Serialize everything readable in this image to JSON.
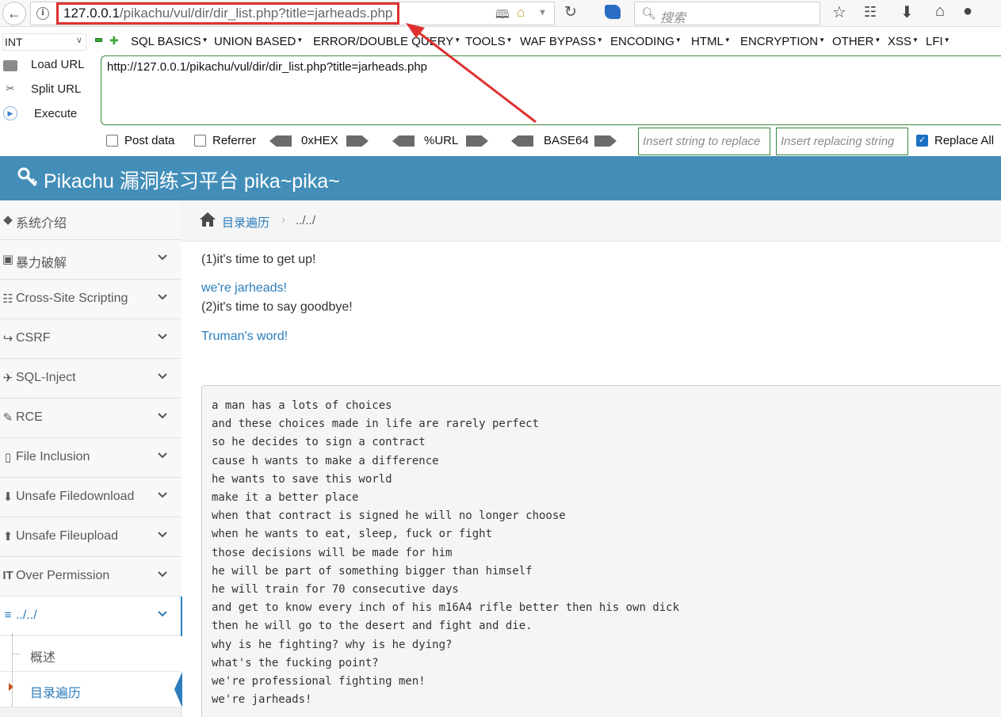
{
  "browser": {
    "url_host": "127.0.0.1",
    "url_path": "/pikachu/vul/dir/dir_list.php?title=jarheads.php",
    "search_placeholder": "搜索"
  },
  "hackbar": {
    "select_value": "INT",
    "menu": [
      "SQL BASICS",
      "UNION BASED",
      "ERROR/DOUBLE QUERY",
      "TOOLS",
      "WAF BYPASS",
      "ENCODING",
      "HTML",
      "ENCRYPTION",
      "OTHER",
      "XSS",
      "LFI"
    ],
    "load_url": "Load URL",
    "split_url": "Split URL",
    "execute": "Execute",
    "url_value": "http://127.0.0.1/pikachu/vul/dir/dir_list.php?title=jarheads.php",
    "post_data": "Post data",
    "referrer": "Referrer",
    "hex": "0xHEX",
    "urlenc": "%URL",
    "base64": "BASE64",
    "replace_ph": "Insert string to replace",
    "replacing_ph": "Insert replacing string",
    "replace_all": "Replace All"
  },
  "app": {
    "title": "Pikachu 漏洞练习平台 pika~pika~"
  },
  "sidebar": {
    "items": [
      {
        "label": "系统介绍",
        "icon": "tags-icon"
      },
      {
        "label": "暴力破解",
        "icon": "lock-icon"
      },
      {
        "label": "Cross-Site Scripting",
        "icon": "sitemap-icon"
      },
      {
        "label": "CSRF",
        "icon": "external-link-icon"
      },
      {
        "label": "SQL-Inject",
        "icon": "plane-icon"
      },
      {
        "label": "RCE",
        "icon": "pencil-icon"
      },
      {
        "label": "File Inclusion",
        "icon": "file-icon"
      },
      {
        "label": "Unsafe Filedownload",
        "icon": "download-icon"
      },
      {
        "label": "Unsafe Fileupload",
        "icon": "upload-icon"
      },
      {
        "label": "Over Permission",
        "icon": "text-icon"
      },
      {
        "label": "../../",
        "icon": "list-icon"
      }
    ],
    "sub_items": [
      "概述",
      "目录遍历"
    ]
  },
  "breadcrumb": {
    "link": "目录遍历",
    "separator": "›",
    "current": "../../"
  },
  "content": {
    "line1": "(1)it's time to get up!",
    "link1": "we're jarheads!",
    "line2": "(2)it's time to say goodbye!",
    "link2": "Truman's word!",
    "poem": [
      "a man has a lots of choices",
      "and these choices made in life are rarely perfect",
      "so he decides to sign a contract",
      "cause h wants to make a difference",
      "he wants to save this world",
      "make it a better place",
      "when that contract is signed he will no longer choose",
      "when he wants to eat, sleep, fuck or fight",
      "those decisions will be made for him",
      "he will be part of something bigger than himself",
      "he will train for 70 consecutive days",
      "and get to know every inch of his m16A4 rifle better then his own dick",
      "then he will go to the desert and fight and die.",
      "why is he fighting? why is he dying?",
      "what's the fucking point?",
      "we're professional fighting men!",
      "we're jarheads!"
    ]
  },
  "colors": {
    "header": "#438eb9",
    "link": "#2b7dbc",
    "annotation": "#e03131"
  }
}
